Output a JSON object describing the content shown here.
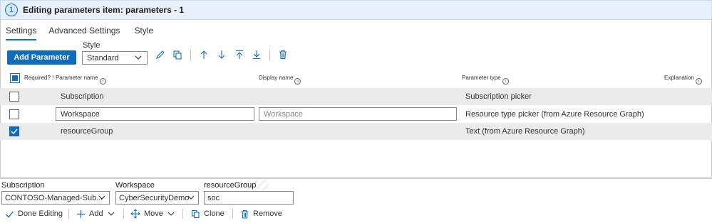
{
  "header": {
    "step": "1",
    "title": "Editing parameters item: parameters - 1"
  },
  "tabs": [
    {
      "label": "Settings",
      "active": true
    },
    {
      "label": "Advanced Settings",
      "active": false
    },
    {
      "label": "Style",
      "active": false
    }
  ],
  "toolbar": {
    "add_parameter_label": "Add Parameter",
    "style_label": "Style",
    "style_value": "Standard",
    "icons": [
      "pencil-icon",
      "copy-icon",
      "arrow-up-icon",
      "arrow-down-icon",
      "move-to-top-icon",
      "move-to-bottom-icon",
      "delete-icon"
    ]
  },
  "table": {
    "columns": {
      "required": "Required? !",
      "parameter_name": "Parameter name",
      "display_name": "Display name",
      "parameter_type": "Parameter type",
      "explanation": "Explanation"
    },
    "rows": [
      {
        "required": false,
        "parameter_name": "Subscription",
        "display_name": "",
        "parameter_type": "Subscription picker",
        "editing": false
      },
      {
        "required": false,
        "parameter_name": "Workspace",
        "display_name": "Workspace",
        "parameter_type": "Resource type picker (from Azure Resource Graph)",
        "editing": true
      },
      {
        "required": true,
        "parameter_name": "resourceGroup",
        "display_name": "",
        "parameter_type": "Text (from Azure Resource Graph)",
        "editing": false
      }
    ]
  },
  "preview": {
    "subscription": {
      "label": "Subscription",
      "value": "CONTOSO-Managed-Sub..."
    },
    "workspace": {
      "label": "Workspace",
      "value": "CyberSecurityDemo"
    },
    "resource_group": {
      "label": "resourceGroup",
      "value": "soc"
    }
  },
  "commandbar": {
    "done_editing": "Done Editing",
    "add": "Add",
    "move": "Move",
    "clone": "Clone",
    "remove": "Remove"
  },
  "colors": {
    "accent": "#0f6cbd",
    "header_bg": "#e8f1fb",
    "row_shaded": "#ebebeb"
  }
}
